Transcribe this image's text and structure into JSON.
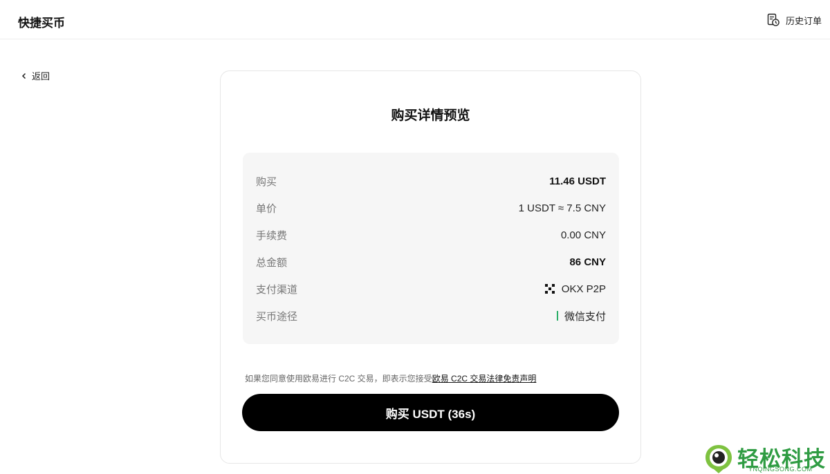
{
  "header": {
    "title": "快捷买币",
    "history_label": "历史订单",
    "history_icon": "order-history-icon"
  },
  "back": {
    "label": "返回",
    "icon": "chevron-left-icon"
  },
  "card": {
    "title": "购买详情预览",
    "rows": [
      {
        "label": "购买",
        "value": "11.46 USDT",
        "emphasis": true
      },
      {
        "label": "单价",
        "value": "1 USDT ≈ 7.5 CNY",
        "emphasis": false
      },
      {
        "label": "手续费",
        "value": "0.00 CNY",
        "emphasis": false
      },
      {
        "label": "总金额",
        "value": "86 CNY",
        "emphasis": true
      },
      {
        "label": "支付渠道",
        "value": "OKX P2P",
        "icon": "okx-logo-icon"
      },
      {
        "label": "买币途径",
        "value": "微信支付",
        "accent_color": "#2aae67"
      }
    ],
    "disclaimer_text": "如果您同意使用欧易进行 C2C 交易，即表示您接受",
    "disclaimer_link": "欧易 C2C 交易法律免责声明",
    "buy_button_label": "购买 USDT (36s)"
  },
  "watermark": {
    "text": "轻松科技",
    "subtext": "YNQINGSONG.COM",
    "color": "#2f9c43"
  }
}
